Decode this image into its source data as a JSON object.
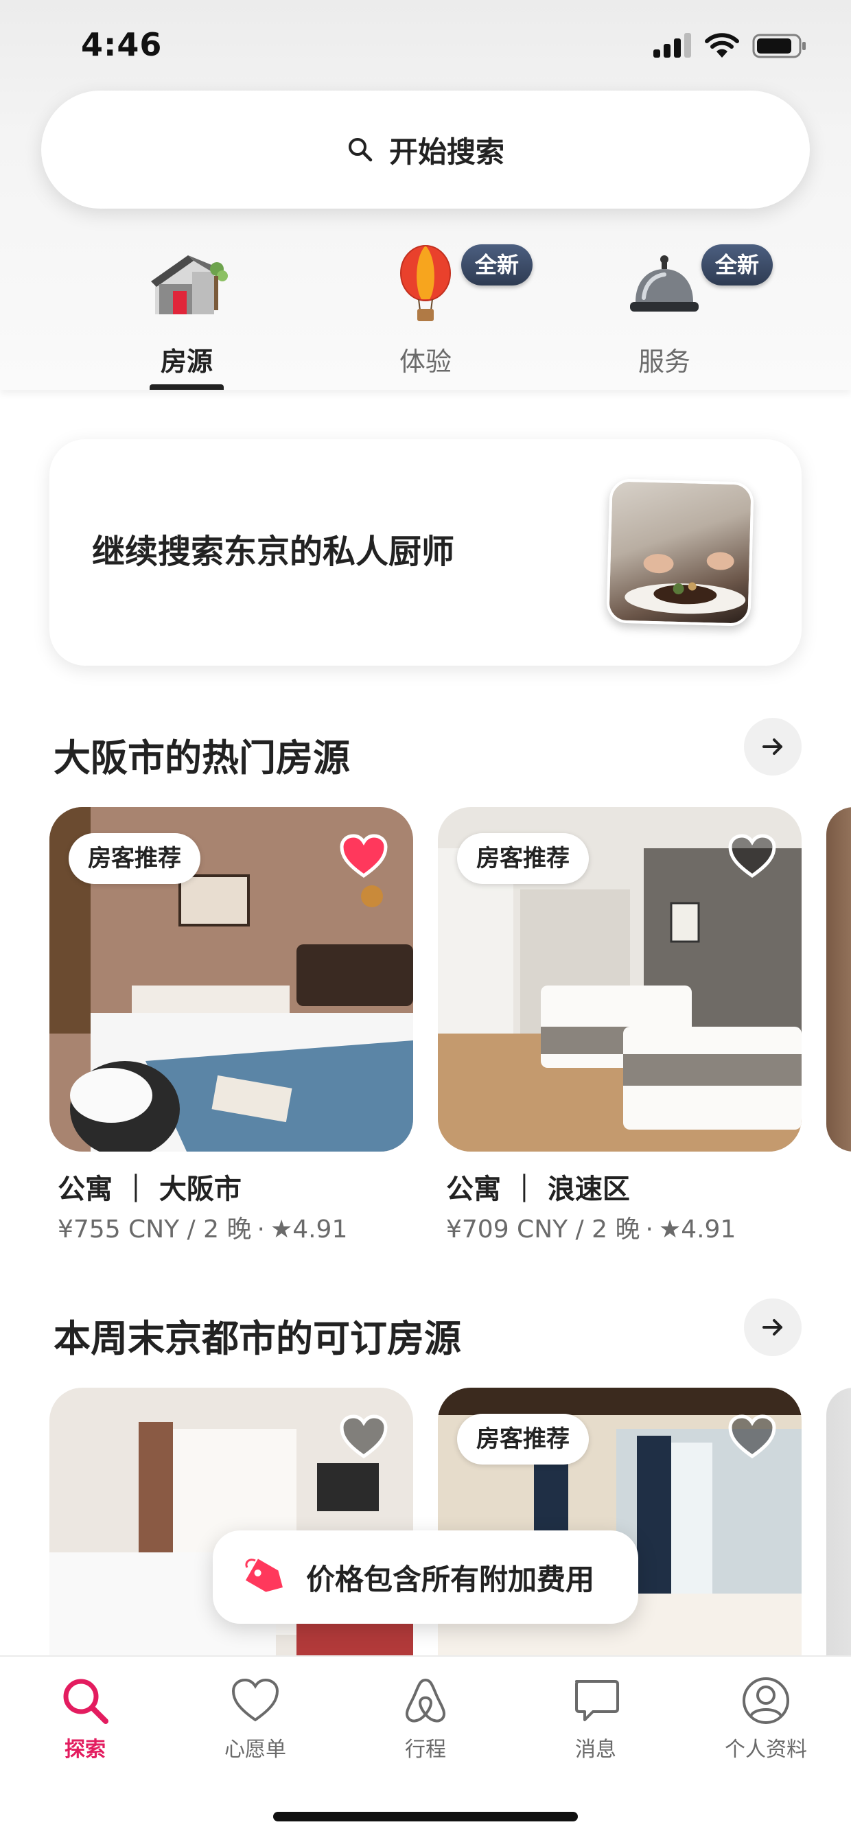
{
  "status_bar": {
    "time": "4:46"
  },
  "search": {
    "label": "开始搜索"
  },
  "categories": [
    {
      "label": "房源",
      "icon": "house-icon",
      "active": true
    },
    {
      "label": "体验",
      "icon": "hot-air-balloon-icon",
      "badge": "全新"
    },
    {
      "label": "服务",
      "icon": "service-bell-icon",
      "badge": "全新"
    }
  ],
  "promo": {
    "text": "继续搜索东京的私人厨师",
    "image": "chef-plating-photo"
  },
  "sections": [
    {
      "title": "大阪市的热门房源",
      "listings": [
        {
          "tag": "房客推荐",
          "favorited": true,
          "title": "公寓 ｜ 大阪市",
          "price": "¥755 CNY / 2 晚",
          "rating": "★4.91"
        },
        {
          "tag": "房客推荐",
          "favorited": false,
          "title": "公寓 ｜ 浪速区",
          "price": "¥709 CNY / 2 晚",
          "rating": "★4.91"
        }
      ]
    },
    {
      "title": "本周末京都市的可订房源",
      "listings": [
        {
          "tag": "",
          "favorited": false
        },
        {
          "tag": "房客推荐",
          "favorited": false
        }
      ]
    }
  ],
  "fee_notice": {
    "text": "价格包含所有附加费用"
  },
  "bottom_nav": [
    {
      "label": "探索",
      "icon": "search-icon",
      "active": true
    },
    {
      "label": "心愿单",
      "icon": "heart-icon"
    },
    {
      "label": "行程",
      "icon": "airbnb-logo-icon"
    },
    {
      "label": "消息",
      "icon": "message-icon"
    },
    {
      "label": "个人资料",
      "icon": "profile-icon"
    }
  ],
  "colors": {
    "brand": "#E31C5F",
    "badge": "#3A4A66",
    "text": "#222222",
    "muted": "#6A6A6A"
  }
}
